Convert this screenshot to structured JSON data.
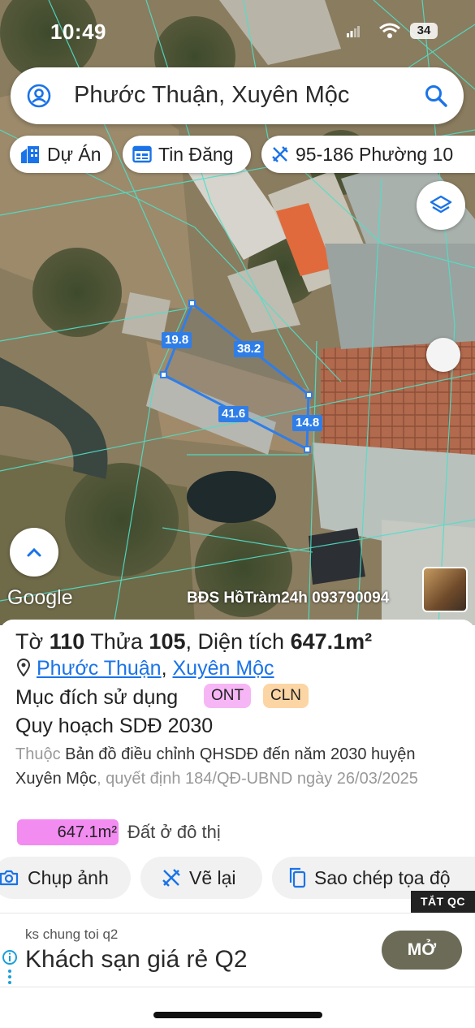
{
  "status_bar": {
    "time": "10:49",
    "battery": "34"
  },
  "search": {
    "query": "Phước Thuận, Xuyên Mộc"
  },
  "chips": [
    {
      "label": "Dự Án",
      "icon": "building-icon"
    },
    {
      "label": "Tin Đăng",
      "icon": "calendar-icon"
    },
    {
      "label": "95-186 Phường 10",
      "icon": "measure-icon"
    }
  ],
  "map": {
    "google_label": "Google",
    "watermark": "BĐS HồTràm24h 093790094",
    "edge_labels": [
      "19.8",
      "38.2",
      "41.6",
      "14.8"
    ],
    "colors": {
      "parcel_outline": "#2f7ee8",
      "grid_lines": "#4fe0c9"
    }
  },
  "parcel": {
    "sheet_label": "Tờ",
    "sheet_no": "110",
    "plot_label": "Thửa",
    "plot_no": "105",
    "area_label": "Diện tích",
    "area": "647.1m²",
    "ward": "Phước Thuận",
    "district": "Xuyên Mộc",
    "purpose_label": "Mục đích sử dụng",
    "purpose_badges": [
      {
        "code": "ONT",
        "color": "#f6b6f5"
      },
      {
        "code": "CLN",
        "color": "#fcd5a4"
      }
    ],
    "planning_title": "Quy hoạch SDĐ 2030",
    "planning_belongs": "Thuộc",
    "planning_map": "Bản đồ điều chỉnh QHSDĐ đến năm 2030 huyện Xuyên Mộc",
    "planning_decision": ", quyết định 184/QĐ-UBND ngày 26/03/2025",
    "area_bar_value": "647.1m²",
    "area_bar_label": "Đất ở đô thị",
    "area_bar_color": "#f28cf1"
  },
  "actions": [
    {
      "label": "Chụp ảnh",
      "icon": "camera-icon"
    },
    {
      "label": "Vẽ lại",
      "icon": "redraw-icon"
    },
    {
      "label": "Sao chép tọa độ",
      "icon": "copy-icon"
    }
  ],
  "ad": {
    "close_label": "TẮT QC",
    "advertiser": "ks chung toi q2",
    "headline": "Khách sạn giá rẻ Q2",
    "cta": "MỞ"
  }
}
